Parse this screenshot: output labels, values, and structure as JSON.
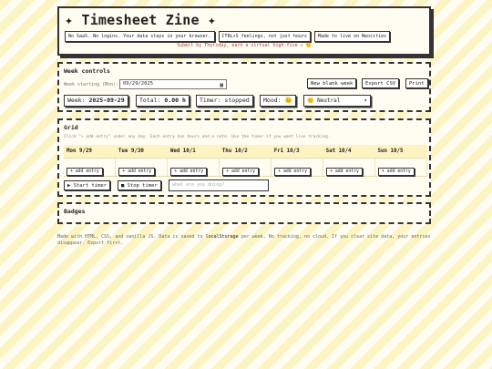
{
  "header": {
    "title": "✦ Timesheet Zine ✦",
    "pills": [
      "No SaaS. No logins. Your data stays in your browser.",
      "CTRL+S feelings, not just hours",
      "Made to live on Neocities"
    ],
    "subtitle": "Submit by Thursday, earn a virtual high-five ✦ 🙂"
  },
  "controls": {
    "title": "Week controls",
    "week_start_label": "Week starting (Mon):",
    "week_start_value": "09/29/2025",
    "new_week": "New blank week",
    "export": "Export CSV",
    "print": "Print",
    "week_label": "Week:",
    "week_value": "2025-09-29",
    "total_label": "Total:",
    "total_value": "0.00 h",
    "timer_label": "Timer:",
    "timer_value": "stopped",
    "mood_label": "Mood:",
    "mood_emoji": "😐",
    "mood_select": "😐 Neutral"
  },
  "grid": {
    "title": "Grid",
    "hint": "Click \"+ add entry\" under any day. Each entry has hours and a note. Use the timer if you want live tracking.",
    "days": [
      "Mon 9/29",
      "Tue 9/30",
      "Wed 10/1",
      "Thu 10/2",
      "Fri 10/3",
      "Sat 10/4",
      "Sun 10/5"
    ],
    "add_entry": "+ add entry",
    "start_timer": "▶ Start timer",
    "stop_timer": "■ Stop timer",
    "doing_placeholder": "what are you doing?"
  },
  "badges": {
    "title": "Badges"
  },
  "footer": {
    "pre": "Made with HTML, CSS, and vanilla JS. Data is saved to ",
    "code": "localStorage",
    "post": " per week. No tracking, no cloud. If you clear site data, your entries disappear. Export first."
  }
}
